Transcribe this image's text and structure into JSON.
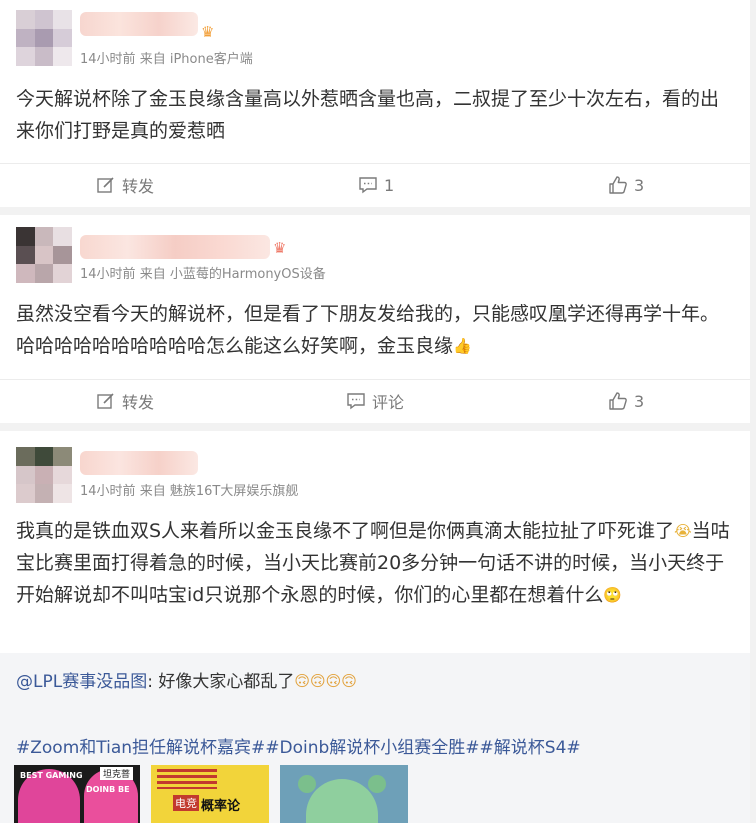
{
  "posts": [
    {
      "time": "14小时前",
      "from": "来自",
      "source": "iPhone客户端",
      "content": "今天解说杯除了金玉良缘含量高以外惹晒含量也高，二叔提了至少十次左右，看的出来你们打野是真的爱惹晒",
      "repost_label": "转发",
      "comment_label": "1",
      "like_count": "3"
    },
    {
      "time": "14小时前",
      "from": "来自",
      "source": "小蓝莓的HarmonyOS设备",
      "content": "虽然没空看今天的解说杯，但是看了下朋友发给我的，只能感叹凰学还得再学十年。哈哈哈哈哈哈哈哈哈哈怎么能这么好笑啊，金玉良缘",
      "repost_label": "转发",
      "comment_label": "评论",
      "like_count": "3"
    },
    {
      "time": "14小时前",
      "from": "来自",
      "source": "魅族16T大屏娱乐旗舰",
      "content_a": "我真的是铁血双S人来着所以金玉良缘不了啊但是你俩真滴太能拉扯了吓死谁了",
      "content_b": "当咕宝比赛里面打得着急的时候，当小天比赛前20多分钟一句话不讲的时候，当小天终于开始解说却不叫咕宝id只说那个永恩的时候，你们的心里都在想着什么",
      "repost": {
        "mention": "@LPL赛事没品图",
        "text": ": 好像大家心都乱了",
        "tags": "#Zoom和Tian担任解说杯嘉宾##Doinb解说杯小组赛全胜##解说杯S4#",
        "thumb_texts": {
          "t1_a": "BEST GAMING",
          "t1_b": "DOINB BE",
          "t1_c": "坦克菩",
          "t2_a": "电竞",
          "t2_b": "概率论"
        }
      }
    }
  ],
  "icons": {
    "repost": "edit-square-icon",
    "comment": "comment-bubble-icon",
    "like": "thumbs-up-icon"
  },
  "colors": {
    "link": "#3b5998",
    "meta": "#8a8a8a",
    "text": "#333333"
  }
}
